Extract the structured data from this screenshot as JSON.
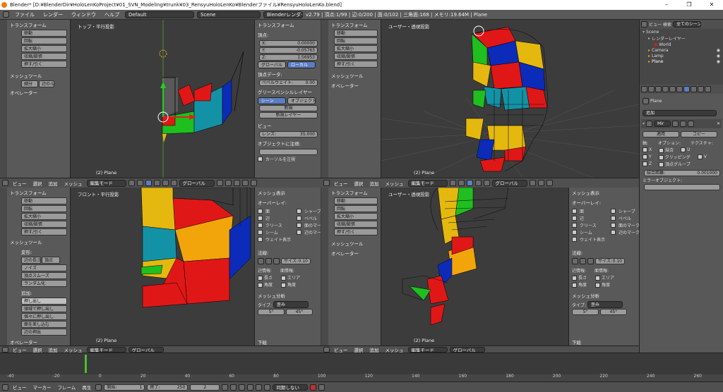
{
  "titlebar": {
    "title": "Blender* [D:¥BlenderDir¥HoloLenKoProject¥01_SVN_Modeling¥trunk¥03_RensyuHoloLenKo¥Blenderファイル¥RensyuHoloLenKo.blend]",
    "minimize": "–",
    "maximize": "❐",
    "close": "✕"
  },
  "menubar": {
    "items": [
      "ファイル",
      "レンダー",
      "ウィンドウ",
      "ヘルプ"
    ],
    "layout": "Default",
    "scene": "Scene",
    "engine": "Blenderレンダー",
    "stats": "v2.79 | 頂点:1/99 | 辺:0/200 | 面:0/102 | 三角面:168 | メモリ:19.64M | Plane"
  },
  "tools_top": {
    "transform": "トランスフォーム",
    "buttons": [
      "移動",
      "回転",
      "拡大縮小",
      "収縮/膨張",
      "押す/引く"
    ],
    "mesh_tools": "メッシュツール",
    "subdiv": "細分",
    "subdiv2": "辺のループ",
    "operator": "オペレーター"
  },
  "tools_front": {
    "transform": "トランスフォーム",
    "buttons": [
      "移動",
      "回転",
      "拡大縮小",
      "収縮/膨張",
      "押す/引く"
    ],
    "mesh_tools": "メッシュツール",
    "deform": "変形:",
    "deform_btns": [
      "辺の長さ",
      "頂点",
      "ノイズ",
      "頂点スムーズ",
      "ランダム化"
    ],
    "add": "追加:",
    "add_btns": [
      "押し出し",
      "領域で押し出し",
      "個々に押し出し",
      "面を差し込む",
      "辺の押出"
    ],
    "operator": "オペレーター"
  },
  "tools_br": {
    "transform": "トランスフォーム",
    "buttons": [
      "移動",
      "回転",
      "拡大縮小",
      "収縮/膨張",
      "押す/引く"
    ],
    "mesh_tools": "メッシュツール",
    "operator": "オペレーター"
  },
  "viewports": {
    "tl": "トップ・平行投影",
    "tr": "ユーザー・透視投影",
    "bl": "フロント・平行投影",
    "br": "ユーザー・透視投影",
    "obj": "(2) Plane"
  },
  "nprops": {
    "transform": "トランスフォーム",
    "vertex": "頂点:",
    "x_label": "X:",
    "x": "0.00000",
    "y_label": "Y:",
    "y": "-0.05763",
    "z_label": "Z:",
    "z": "1.56953",
    "global": "グローバル",
    "local": "ローカル",
    "vdata": "頂点データ:",
    "bevel": "ベベルウェイト:",
    "bevel_val": "0.00",
    "gp": "グリースペンシルレイヤー",
    "gp_scene": "シーン",
    "gp_obj": "オブジェクト",
    "gp_new": "新規",
    "gp_newlayer": "新規レイヤー",
    "view": "ビュー",
    "lens": "レンズ:",
    "lens_val": "35.000",
    "lock": "オブジェクトに注視:",
    "cursor": "カーソルを注視"
  },
  "nprops2": {
    "mesh_display": "メッシュ表示",
    "overlay": "オーバーレイ:",
    "opts_l": [
      "面",
      "辺",
      "クリース",
      "シーム",
      "ウェイト表示"
    ],
    "opts_r": [
      "シャープ",
      "ベベル",
      "面のマーク",
      "辺のマーク"
    ],
    "normals": "法線:",
    "size": "サイズ:",
    "size_val": "0.10",
    "edge_info": "辺情報:",
    "face_info": "面情報:",
    "ei": [
      "長さ",
      "角度"
    ],
    "fi": [
      "エリア",
      "角度"
    ],
    "analysis": "メッシュ分析",
    "type": "タイプ:",
    "type_val": "歪み",
    "v1": "5°",
    "v2": "45°",
    "bottom": "下絵"
  },
  "vheader": {
    "items": [
      "ビュー",
      "選択",
      "追加",
      "メッシュ"
    ],
    "mode": "編集モード",
    "orient": "グローバル"
  },
  "outliner": {
    "view": "ビュー",
    "search": "検索",
    "scenes": "全てのシーン",
    "tree": [
      "Scene",
      "レンダーレイヤー",
      "World",
      "Camera",
      "Lamp",
      "Plane"
    ]
  },
  "propsr": {
    "obj": "Plane",
    "add": "追加",
    "mod_name": "Mir",
    "apply": "適用",
    "copy": "コピー",
    "axis": "軸:",
    "options": "オプション:",
    "texture": "テクスチャ:",
    "x": "X",
    "y": "Y",
    "z": "Z",
    "merge": "結合",
    "clip": "クリッピング",
    "vgroup": "頂点グループ",
    "u": "U",
    "v": "V",
    "merge_dist": "結合距離:",
    "merge_val": "0.001000",
    "mirror_obj": "ミラーオブジェクト:"
  },
  "timeline": {
    "ticks": [
      "-40",
      "-20",
      "0",
      "20",
      "40",
      "60",
      "80",
      "100",
      "120",
      "140",
      "160",
      "180",
      "200",
      "220",
      "240",
      "260"
    ],
    "items": [
      "ビュー",
      "マーカー",
      "フレーム",
      "再生"
    ],
    "start_label": "開始:",
    "start": "1",
    "end_label": "終了:",
    "end": "250",
    "current": "2",
    "sync": "同期しない"
  },
  "colors": {
    "blue": "#0b2bb8",
    "red": "#e01717",
    "green": "#1fbf1f",
    "yellow": "#e4b80f",
    "orange": "#f2a50a",
    "teal": "#1392a6"
  }
}
